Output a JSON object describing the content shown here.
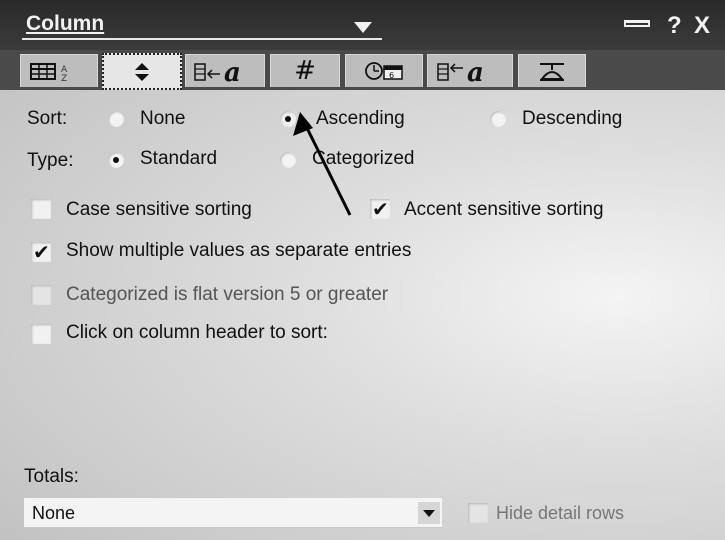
{
  "title_bar": {
    "title": "Column",
    "help": "?",
    "close": "X"
  },
  "tabs": [
    {
      "name": "basics",
      "icon": "columns-sort-icon"
    },
    {
      "name": "sorting",
      "icon": "sort-arrows-icon",
      "active": true
    },
    {
      "name": "font",
      "icon": "column-font-icon"
    },
    {
      "name": "numbers",
      "icon": "hash-icon",
      "text": "#"
    },
    {
      "name": "date-time",
      "icon": "date-time-icon"
    },
    {
      "name": "title-font",
      "icon": "title-font-icon"
    },
    {
      "name": "advanced",
      "icon": "propeller-hat-icon"
    }
  ],
  "sort": {
    "label": "Sort:",
    "options": [
      "None",
      "Ascending",
      "Descending"
    ],
    "selected": "Ascending"
  },
  "type": {
    "label": "Type:",
    "options": [
      "Standard",
      "Categorized"
    ],
    "selected": "Standard"
  },
  "checkboxes": {
    "case_sensitive": {
      "label": "Case sensitive sorting",
      "checked": false
    },
    "accent_sensitive": {
      "label": "Accent sensitive sorting",
      "checked": true
    },
    "multiple_values": {
      "label": "Show multiple values as separate entries",
      "checked": true
    },
    "categorized_flat": {
      "label": "Categorized is flat version 5 or greater",
      "checked": false,
      "disabled": true
    },
    "click_header": {
      "label": "Click on column header to sort:",
      "checked": false
    }
  },
  "totals": {
    "label": "Totals:",
    "value": "None",
    "hide_detail_label": "Hide detail rows"
  },
  "letters": {
    "a": "a"
  }
}
